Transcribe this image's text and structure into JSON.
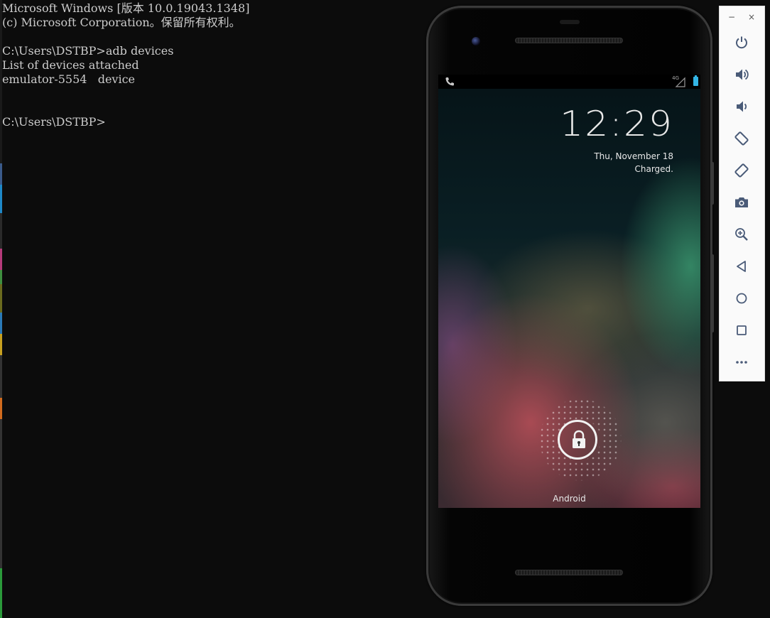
{
  "console": {
    "lines": [
      "Microsoft Windows [版本 10.0.19043.1348]",
      "(c) Microsoft Corporation。保留所有权利。",
      "",
      "C:\\Users\\DSTBP>adb devices",
      "List of devices attached",
      "emulator-5554   device",
      "",
      "",
      "C:\\Users\\DSTBP>"
    ]
  },
  "emulator": {
    "status_bar": {
      "network_label": "4G",
      "left_icon": "phone-icon",
      "right_icons": [
        "signal-icon",
        "battery-icon"
      ]
    },
    "lockscreen": {
      "time": "12:29",
      "date": "Thu, November 18",
      "charge_status": "Charged.",
      "carrier": "Android",
      "lock_icon": "lock-icon"
    }
  },
  "toolbar": {
    "window_controls": {
      "minimize": "−",
      "close": "×"
    },
    "buttons": [
      {
        "name": "power-button",
        "icon": "power-icon"
      },
      {
        "name": "volume-up-button",
        "icon": "volume-up-icon"
      },
      {
        "name": "volume-down-button",
        "icon": "volume-down-icon"
      },
      {
        "name": "rotate-left-button",
        "icon": "rotate-left-icon"
      },
      {
        "name": "rotate-right-button",
        "icon": "rotate-right-icon"
      },
      {
        "name": "screenshot-button",
        "icon": "camera-icon"
      },
      {
        "name": "zoom-button",
        "icon": "zoom-icon"
      },
      {
        "name": "back-button",
        "icon": "back-triangle-icon"
      },
      {
        "name": "home-button",
        "icon": "home-circle-icon"
      },
      {
        "name": "overview-button",
        "icon": "overview-square-icon"
      },
      {
        "name": "more-button",
        "icon": "more-dots-icon"
      }
    ],
    "icon_color": "#4a5b78"
  }
}
